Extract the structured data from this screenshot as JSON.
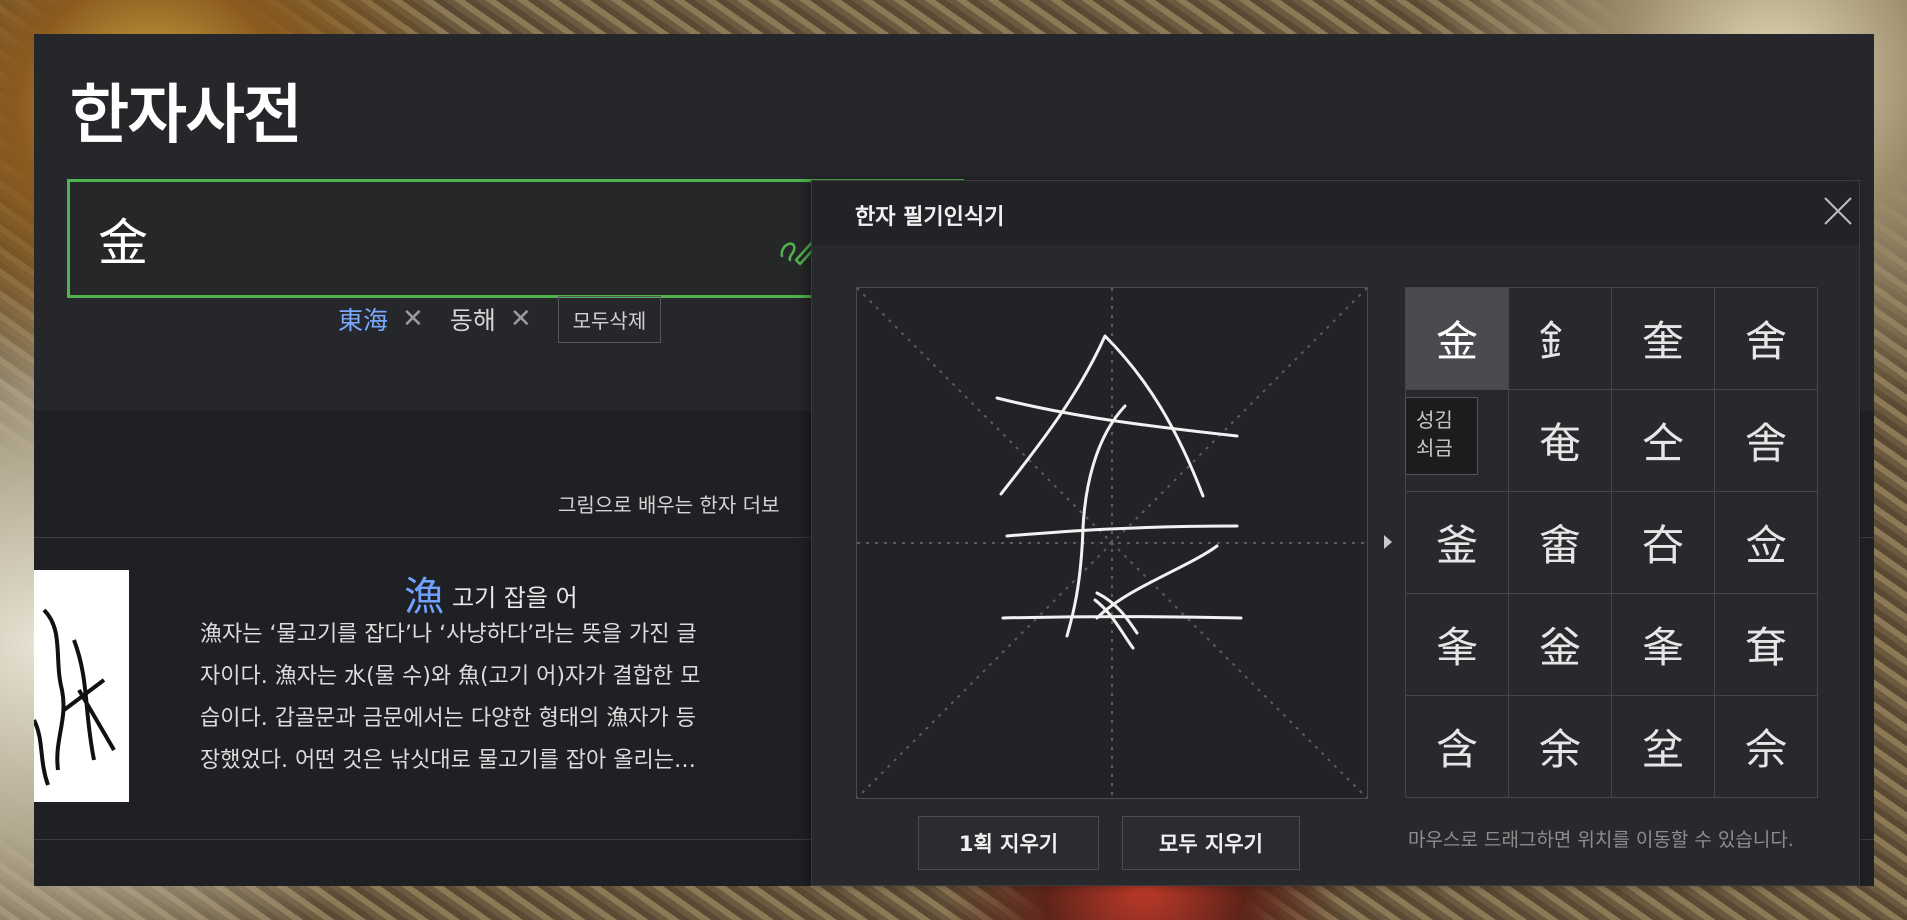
{
  "app": {
    "title": "한자사전"
  },
  "search": {
    "value": "金"
  },
  "recent": {
    "items": [
      {
        "label": "東海",
        "color": "#79a8ff"
      },
      {
        "label": "동해",
        "color": "#d6d6d6"
      }
    ],
    "clear_all_label": "모두삭제"
  },
  "content": {
    "more_link": "그림으로 배우는 한자 더보",
    "card": {
      "hanja": "漁",
      "meaning": "고기 잡을 어",
      "lines": [
        "漁자는 ‘물고기를 잡다’나 ‘사냥하다’라는 뜻을 가진 글",
        "자이다. 漁자는 水(물 수)와 魚(고기 어)자가 결합한 모",
        "습이다. 갑골문과 금문에서는 다양한 형태의 漁자가 등",
        "장했었다. 어떤 것은 낚싯대로 물고기를 잡아 올리는…"
      ]
    }
  },
  "handwriting": {
    "title": "한자 필기인식기",
    "candidates": [
      "金",
      "釒",
      "奎",
      "舍",
      "",
      "奄",
      "仝",
      "舎",
      "釜",
      "畬",
      "夻",
      "佥",
      "夆",
      "釡",
      "夆",
      "耷",
      "含",
      "余",
      "坌",
      "佘"
    ],
    "selected_index": 0,
    "tooltip_lines": [
      "성김",
      "쇠금"
    ],
    "erase_one_label": "1획 지우기",
    "erase_all_label": "모두 지우기",
    "hint": "마우스로 드래그하면 위치를 이동할 수 있습니다."
  },
  "colors": {
    "accent": "#4fb34f",
    "link": "#79a8ff",
    "panel": "#26272a"
  }
}
